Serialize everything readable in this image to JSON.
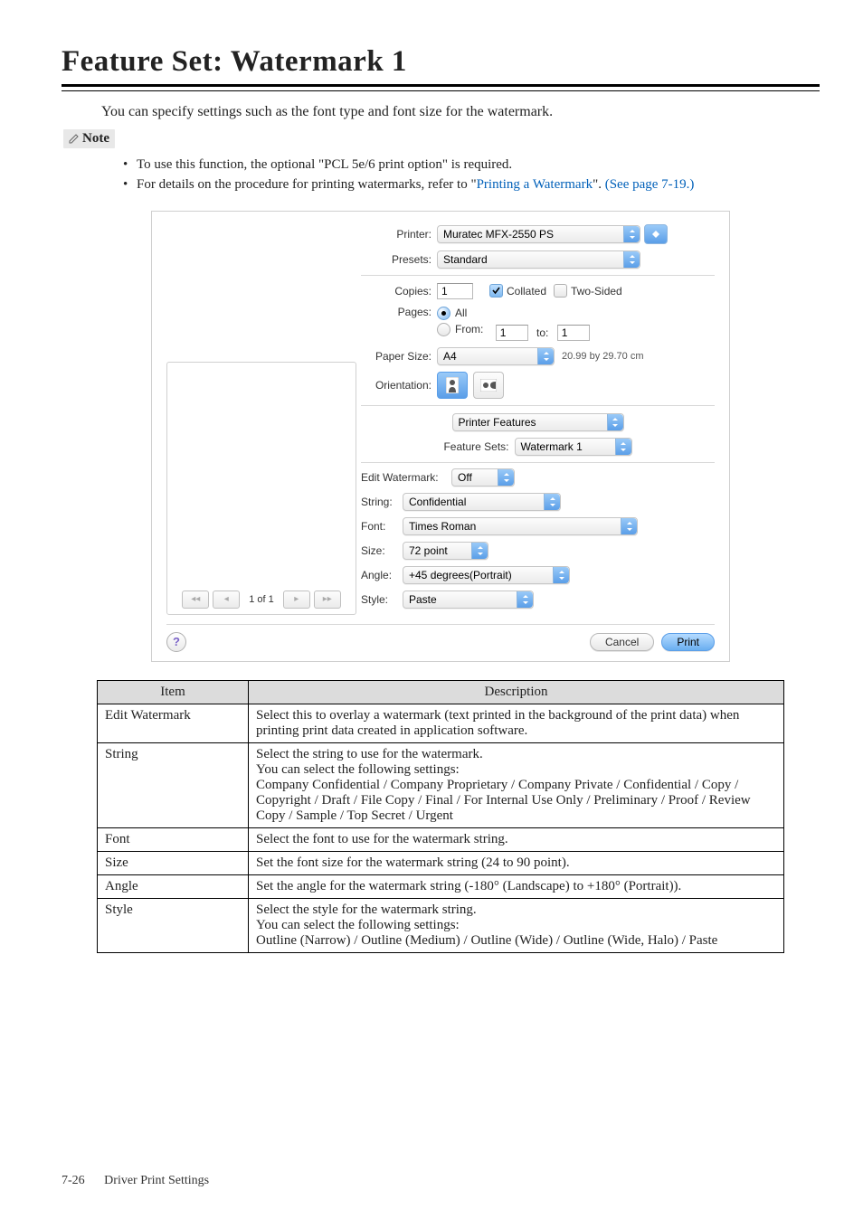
{
  "heading": "Feature Set: Watermark 1",
  "lead": "You can specify settings such as the font type and font size for the watermark.",
  "note_label": "Note",
  "bullets": [
    {
      "plain": "To use this function, the optional \"PCL 5e/6 print option\" is required."
    },
    {
      "pre": "For details on the procedure for printing watermarks, refer to \"",
      "link1": "Printing a Watermark",
      "mid": "\". ",
      "link2": "(See page 7-19.)"
    }
  ],
  "dialog": {
    "printer_label": "Printer:",
    "printer_value": "Muratec MFX-2550 PS",
    "presets_label": "Presets:",
    "presets_value": "Standard",
    "copies_label": "Copies:",
    "copies_value": "1",
    "collated_label": "Collated",
    "twosided_label": "Two-Sided",
    "pages_label": "Pages:",
    "pages_all": "All",
    "pages_from": "From:",
    "pages_from_val": "1",
    "pages_to": "to:",
    "pages_to_val": "1",
    "papersize_label": "Paper Size:",
    "papersize_value": "A4",
    "papersize_dim": "20.99 by 29.70 cm",
    "orientation_label": "Orientation:",
    "panel_label": "Printer Features",
    "featuresets_label": "Feature Sets:",
    "featuresets_value": "Watermark 1",
    "editwm_label": "Edit Watermark:",
    "editwm_value": "Off",
    "string_label": "String:",
    "string_value": "Confidential",
    "font_label": "Font:",
    "font_value": "Times Roman",
    "size_label": "Size:",
    "size_value": "72 point",
    "angle_label": "Angle:",
    "angle_value": "+45 degrees(Portrait)",
    "style_label": "Style:",
    "style_value": "Paste",
    "preview_nav": "1 of 1",
    "help_glyph": "?",
    "cancel": "Cancel",
    "print": "Print"
  },
  "table": {
    "head_item": "Item",
    "head_desc": "Description",
    "rows": [
      {
        "item": "Edit Watermark",
        "desc": "Select this to overlay a watermark (text printed in the background of the print data) when printing print data created in application software."
      },
      {
        "item": "String",
        "desc": "Select the string to use for the watermark.\nYou can select the following settings:\nCompany Confidential / Company Proprietary / Company Private / Confidential / Copy / Copyright / Draft / File Copy / Final / For Internal Use Only / Preliminary / Proof / Review Copy / Sample / Top Secret / Urgent"
      },
      {
        "item": "Font",
        "desc": "Select the font to use for the watermark string."
      },
      {
        "item": "Size",
        "desc": "Set the font size for the watermark string (24 to 90 point)."
      },
      {
        "item": "Angle",
        "desc": "Set the angle for the watermark string (-180° (Landscape) to +180° (Portrait))."
      },
      {
        "item": "Style",
        "desc": "Select the style for the watermark string.\nYou can select the following settings:\nOutline (Narrow) / Outline (Medium) / Outline (Wide) / Outline (Wide, Halo) / Paste"
      }
    ]
  },
  "footer": {
    "page": "7-26",
    "section": "Driver Print Settings"
  }
}
